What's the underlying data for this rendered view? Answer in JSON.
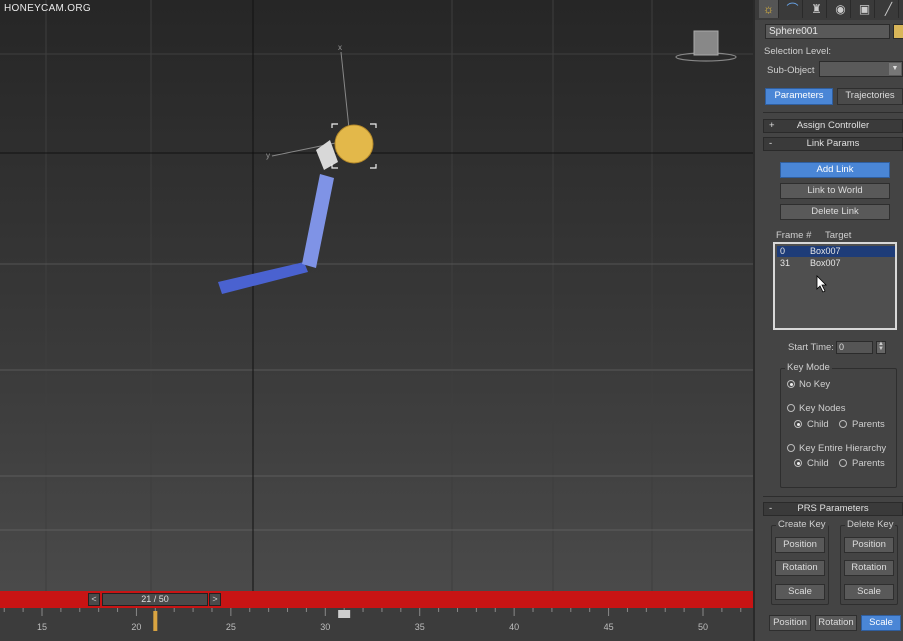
{
  "watermark": "HONEYCAM.ORG",
  "panel": {
    "tabs": [
      {
        "icon": "sun-icon",
        "glyph": "☼"
      },
      {
        "icon": "curve-icon",
        "glyph": "⌒"
      },
      {
        "icon": "hierarchy-icon",
        "glyph": "♜"
      },
      {
        "icon": "motion-icon",
        "glyph": "◉"
      },
      {
        "icon": "display-icon",
        "glyph": "▣"
      },
      {
        "icon": "utilities-icon",
        "glyph": "╱"
      }
    ],
    "object_name": "Sphere001",
    "object_color": "#d9b659",
    "selection_level_label": "Selection Level:",
    "sub_object_label": "Sub-Object",
    "parameters_button": "Parameters",
    "trajectories_button": "Trajectories",
    "assign_controller": {
      "sign": "+",
      "title": "Assign Controller"
    },
    "link_params": {
      "sign": "-",
      "title": "Link Params"
    },
    "add_link": "Add Link",
    "link_to_world": "Link to World",
    "delete_link": "Delete Link",
    "list_headers": {
      "frame": "Frame #",
      "target": "Target"
    },
    "links": [
      {
        "frame": "0",
        "target": "Box007",
        "selected": true
      },
      {
        "frame": "31",
        "target": "Box007",
        "selected": false
      }
    ],
    "start_time_label": "Start Time:",
    "start_time_value": "0",
    "key_mode_title": "Key Mode",
    "no_key": "No Key",
    "key_nodes": "Key Nodes",
    "child_1": "Child",
    "parents_1": "Parents",
    "key_entire_hierarchy": "Key Entire Hierarchy",
    "child_2": "Child",
    "parents_2": "Parents",
    "prs": {
      "sign": "-",
      "title": "PRS Parameters"
    },
    "create_key_title": "Create Key",
    "delete_key_title": "Delete Key",
    "create_position": "Position",
    "create_rotation": "Rotation",
    "create_scale": "Scale",
    "delete_position": "Position",
    "delete_rotation": "Rotation",
    "delete_scale": "Scale",
    "bottom_position": "Position",
    "bottom_rotation": "Rotation",
    "bottom_scale": "Scale"
  },
  "timeline": {
    "prev": "<",
    "next": ">",
    "frame_display": "21 / 50",
    "current_frame": 21,
    "total_frames": 50,
    "ruler_labels": [
      "15",
      "20",
      "25",
      "30",
      "35",
      "40",
      "45",
      "50"
    ]
  },
  "viewport": {
    "axis_labels": {
      "x": "x",
      "y": "y"
    }
  },
  "colors": {
    "timebar": "#c81414",
    "accent_blue": "#4a86d6",
    "bone": "#4a62d0",
    "sphere": "#e3b84a"
  }
}
